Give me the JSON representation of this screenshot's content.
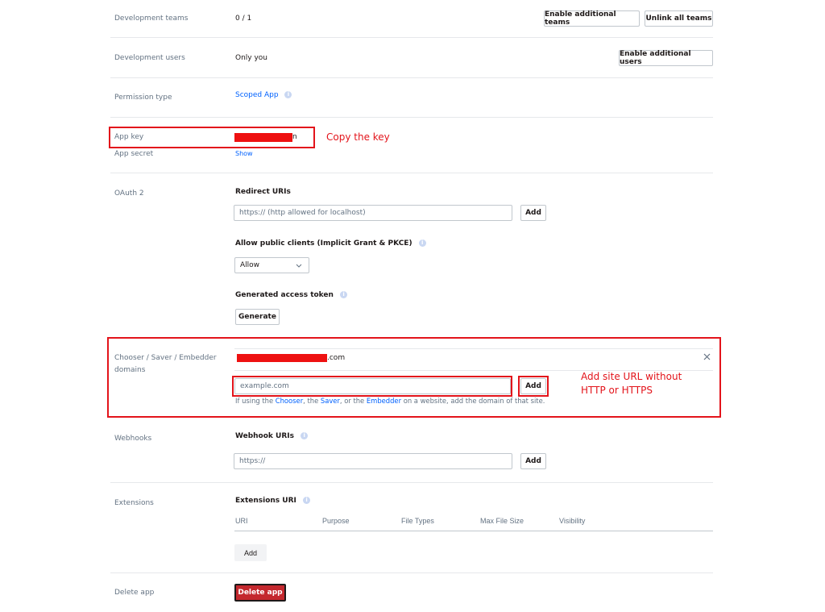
{
  "dev_teams": {
    "label": "Development teams",
    "value": "0 / 1",
    "enable_btn": "Enable additional teams",
    "unlink_btn": "Unlink all teams"
  },
  "dev_users": {
    "label": "Development users",
    "value": "Only you",
    "enable_btn": "Enable additional users"
  },
  "permission": {
    "label": "Permission type",
    "value": "Scoped App"
  },
  "app_key": {
    "label": "App key",
    "visible_suffix": "n"
  },
  "app_secret": {
    "label": "App secret",
    "show_link": "Show"
  },
  "oauth": {
    "label": "OAuth 2",
    "redirect_heading": "Redirect URIs",
    "redirect_placeholder": "https:// (http allowed for localhost)",
    "redirect_add": "Add",
    "public_clients_heading": "Allow public clients (Implicit Grant & PKCE)",
    "public_clients_value": "Allow",
    "token_heading": "Generated access token",
    "token_btn": "Generate"
  },
  "chooser": {
    "label_line1": "Chooser / Saver / Embedder",
    "label_line2": "domains",
    "domain_suffix": ".com",
    "placeholder": "example.com",
    "add": "Add",
    "help_prefix": "If using the ",
    "help_chooser": "Chooser",
    "help_mid1": ", the ",
    "help_saver": "Saver",
    "help_mid2": ", or the ",
    "help_embedder": "Embedder",
    "help_suffix": " on a website, add the domain of that site."
  },
  "webhooks": {
    "label": "Webhooks",
    "heading": "Webhook URIs",
    "placeholder": "https://",
    "add": "Add"
  },
  "extensions": {
    "label": "Extensions",
    "heading": "Extensions URI",
    "columns": [
      "URI",
      "Purpose",
      "File Types",
      "Max File Size",
      "Visibility"
    ],
    "add": "Add"
  },
  "delete": {
    "label": "Delete app",
    "btn": "Delete app"
  },
  "annotations": {
    "copy_key": "Copy the key",
    "add_site_line1": "Add site URL without",
    "add_site_line2": "HTTP or HTTPS"
  },
  "colors": {
    "accent": "#0061fe",
    "annotation": "#e3141b",
    "danger": "#c4282e"
  },
  "icons": [
    "info-icon",
    "chevron-down-icon",
    "close-icon"
  ]
}
